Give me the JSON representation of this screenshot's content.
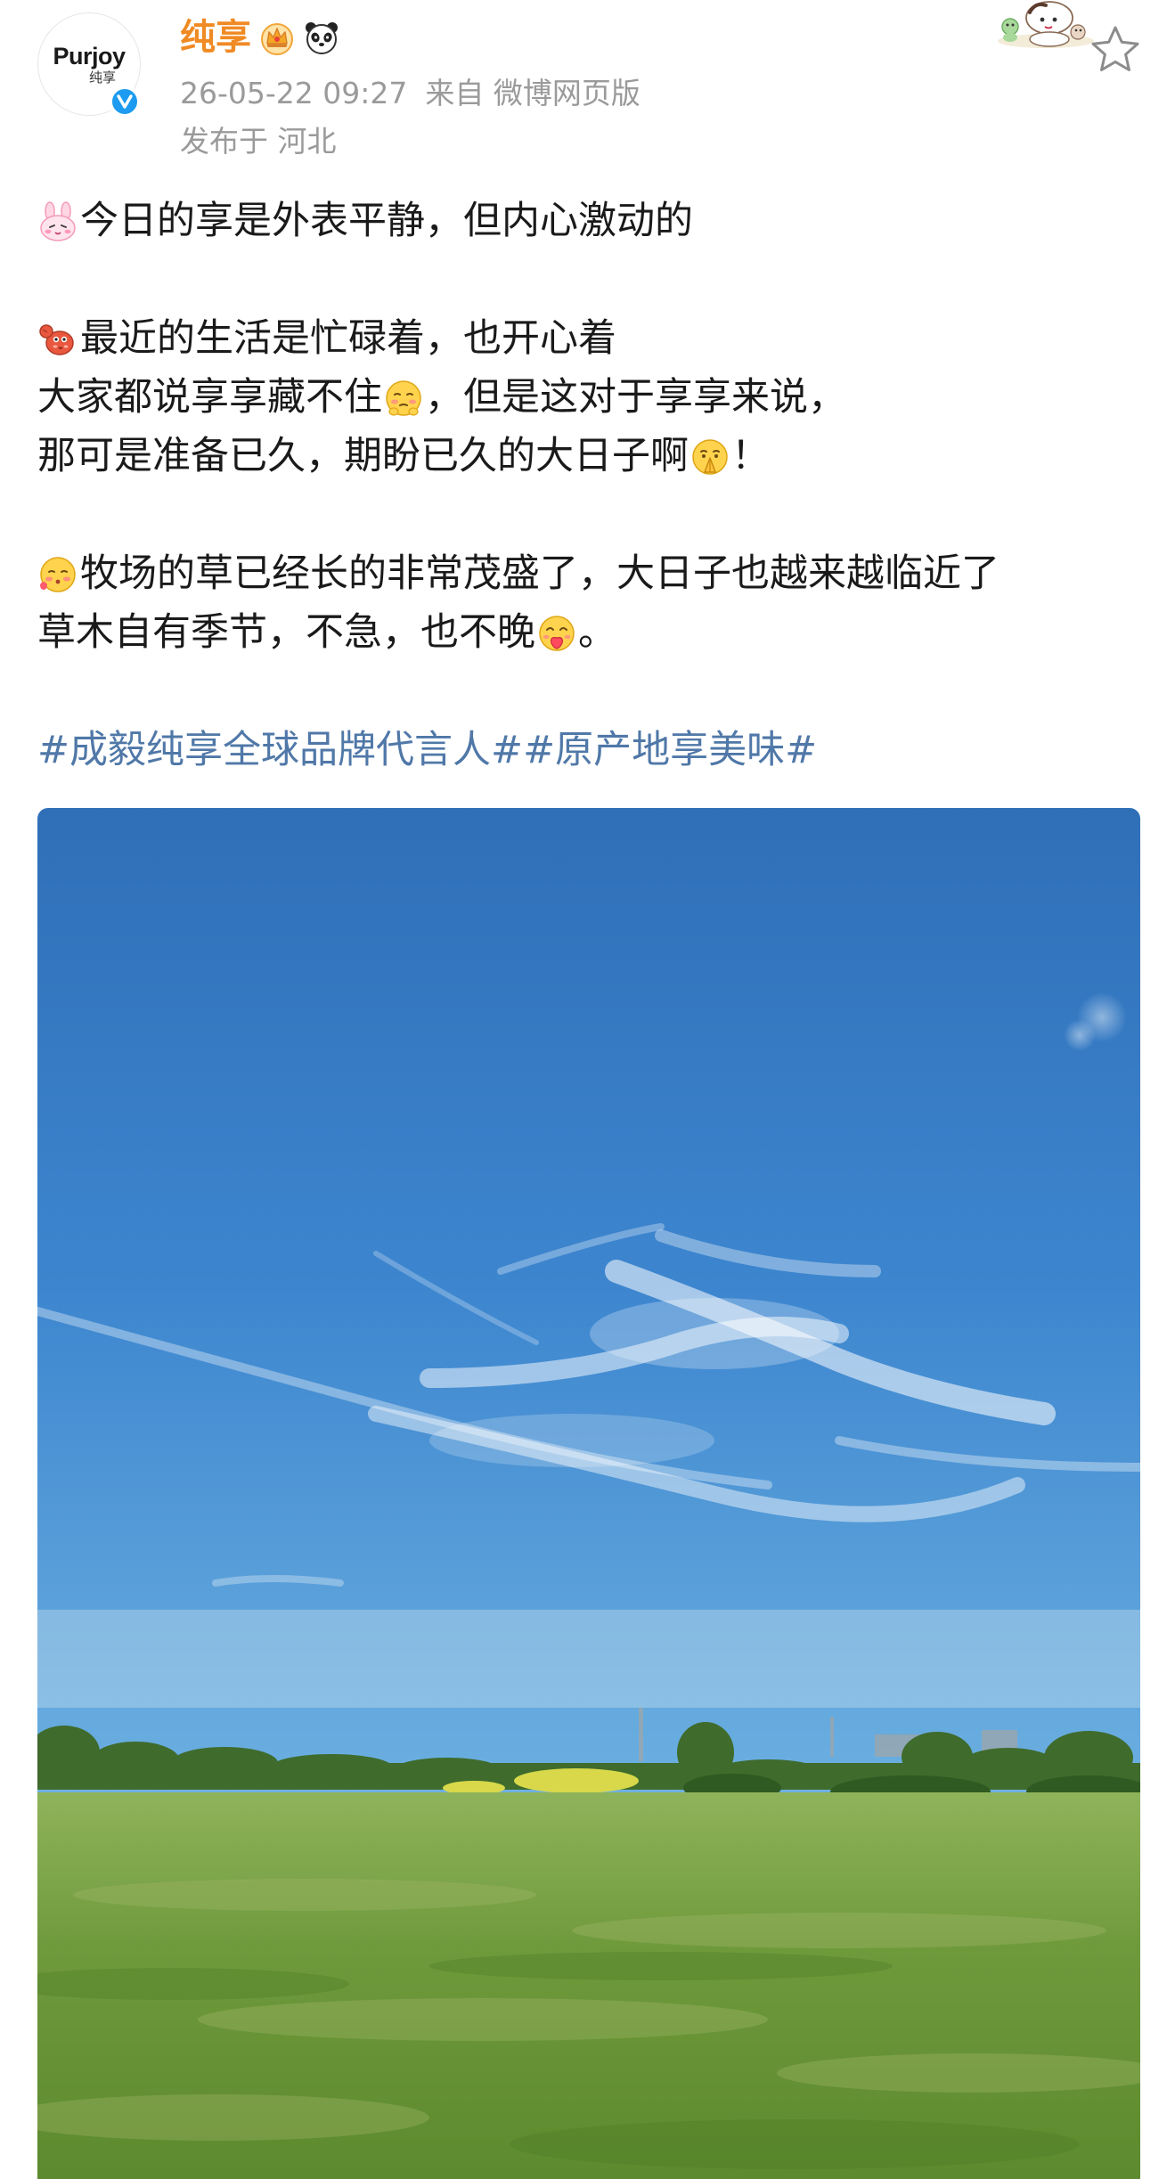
{
  "account": {
    "avatar_brand": "Purjoy",
    "avatar_sub": "纯享",
    "username": "纯享",
    "verified_icon": "verified-v-icon",
    "badges": [
      "crown-badge-icon",
      "panda-badge-icon"
    ]
  },
  "post_meta": {
    "timestamp": "26-05-22 09:27",
    "source": "来自 微博网页版",
    "location": "发布于 河北"
  },
  "header_icons": {
    "sticker": "cartoon-sticker-icon",
    "favorite": "star-icon"
  },
  "post_body": {
    "line1": "今日的享是外表平静，但内心激动的",
    "line2": "最近的生活是忙碌着，也开心着",
    "line3a": "大家都说享享藏不住",
    "line3b": "，但是这对于享享来说，",
    "line4a": "那可是准备已久，期盼已久的大日子啊",
    "line4b": "！",
    "line5": "牧场的草已经长的非常茂盛了，大日子也越来越临近了",
    "line6a": "草木自有季节，不急，也不晚",
    "line6b": "。",
    "emojis": [
      "bunny-emoji-icon",
      "lobster-emoji-icon",
      "shy-face-emoji-icon",
      "praying-face-emoji-icon",
      "blushing-face-emoji-icon",
      "kissing-face-emoji-icon"
    ]
  },
  "hashtags": [
    "#成毅纯享全球品牌代言人#",
    "#原产地享美味#"
  ],
  "photo": {
    "subject": "blue-sky-grassland-photo"
  },
  "colors": {
    "username": "#f08a24",
    "meta": "#9a9a9a",
    "body_text": "#1a1a1a",
    "hashtag": "#5078a8",
    "verified": "#1c9bf0"
  }
}
